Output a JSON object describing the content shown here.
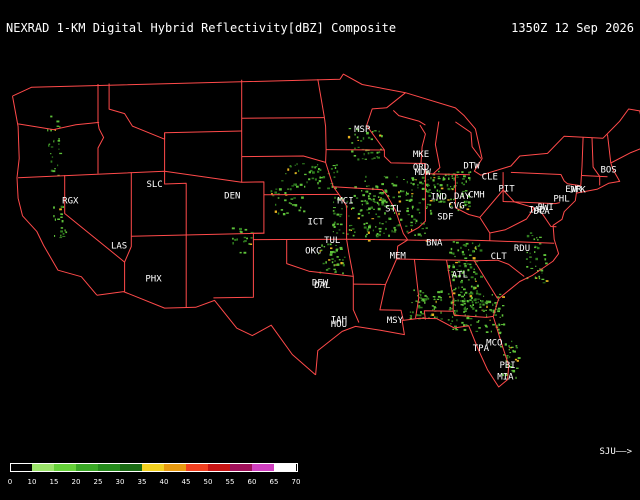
{
  "header": {
    "title": "NEXRAD 1-KM Digital Hybrid Reflectivity[dBZ] Composite",
    "timestamp": "1350Z 12 Sep 2026"
  },
  "cities": [
    {
      "code": "RGX",
      "lon": -119.5,
      "lat": 39.75
    },
    {
      "code": "SLC",
      "lon": -111.9,
      "lat": 40.8
    },
    {
      "code": "LAS",
      "lon": -115.1,
      "lat": 36.1
    },
    {
      "code": "PHX",
      "lon": -112.0,
      "lat": 33.4
    },
    {
      "code": "DEN",
      "lon": -104.9,
      "lat": 39.75
    },
    {
      "code": "MSP",
      "lon": -93.2,
      "lat": 44.9
    },
    {
      "code": "MKE",
      "lon": -87.9,
      "lat": 43.0
    },
    {
      "code": "ORD",
      "lon": -87.9,
      "lat": 41.98
    },
    {
      "code": "MDW",
      "lon": -87.75,
      "lat": 41.6
    },
    {
      "code": "DTW",
      "lon": -83.35,
      "lat": 42.21
    },
    {
      "code": "CLE",
      "lon": -81.7,
      "lat": 41.4
    },
    {
      "code": "CMH",
      "lon": -82.9,
      "lat": 39.95
    },
    {
      "code": "DAY",
      "lon": -84.2,
      "lat": 39.8
    },
    {
      "code": "PIT",
      "lon": -80.2,
      "lat": 40.5
    },
    {
      "code": "IND",
      "lon": -86.3,
      "lat": 39.7
    },
    {
      "code": "CVG",
      "lon": -84.7,
      "lat": 39.05
    },
    {
      "code": "MCI",
      "lon": -94.7,
      "lat": 39.3
    },
    {
      "code": "STL",
      "lon": -90.4,
      "lat": 38.7
    },
    {
      "code": "SDF",
      "lon": -85.7,
      "lat": 38.17
    },
    {
      "code": "ICT",
      "lon": -97.4,
      "lat": 37.65
    },
    {
      "code": "TUL",
      "lon": -95.9,
      "lat": 36.2
    },
    {
      "code": "OKC",
      "lon": -97.6,
      "lat": 35.4
    },
    {
      "code": "BNA",
      "lon": -86.7,
      "lat": 36.1
    },
    {
      "code": "MEM",
      "lon": -90.0,
      "lat": 35.05
    },
    {
      "code": "ATL",
      "lon": -84.4,
      "lat": 33.64
    },
    {
      "code": "CLT",
      "lon": -80.9,
      "lat": 35.2
    },
    {
      "code": "RDU",
      "lon": -78.8,
      "lat": 35.9
    },
    {
      "code": "DFW",
      "lon": -97.0,
      "lat": 32.9
    },
    {
      "code": "DAL",
      "lon": -96.8,
      "lat": 32.7
    },
    {
      "code": "IAH",
      "lon": -95.3,
      "lat": 30.0
    },
    {
      "code": "HOU",
      "lon": -95.3,
      "lat": 29.65
    },
    {
      "code": "MSY",
      "lon": -90.25,
      "lat": 29.99
    },
    {
      "code": "TPA",
      "lon": -82.5,
      "lat": 27.98
    },
    {
      "code": "MCO",
      "lon": -81.3,
      "lat": 28.43
    },
    {
      "code": "PBI",
      "lon": -80.1,
      "lat": 26.7
    },
    {
      "code": "MIA",
      "lon": -80.3,
      "lat": 25.79
    },
    {
      "code": "BOS",
      "lon": -71.0,
      "lat": 42.36
    },
    {
      "code": "JFK",
      "lon": -73.8,
      "lat": 40.64
    },
    {
      "code": "EWR",
      "lon": -74.17,
      "lat": 40.69
    },
    {
      "code": "PHL",
      "lon": -75.24,
      "lat": 39.87
    },
    {
      "code": "BWI",
      "lon": -76.67,
      "lat": 39.18
    },
    {
      "code": "IAD",
      "lon": -77.46,
      "lat": 38.95
    },
    {
      "code": "DCA",
      "lon": -77.04,
      "lat": 38.85
    }
  ],
  "legend": {
    "levels": [
      "0",
      "10",
      "15",
      "20",
      "25",
      "30",
      "35",
      "40",
      "45",
      "50",
      "55",
      "60",
      "65",
      "70"
    ],
    "colors": [
      "#000000",
      "#000000",
      "#9be36a",
      "#66d13a",
      "#3aa826",
      "#258a1c",
      "#1a6b14",
      "#f2d020",
      "#e89a10",
      "#f04020",
      "#c81414",
      "#a0105a",
      "#d040c0",
      "#ffffff"
    ]
  },
  "signature": "SJU——>",
  "colors": {
    "background": "#000000",
    "borders": "#ff4a4a",
    "text": "#ffffff",
    "echo_light": "#5ec23a",
    "echo_dark": "#2f7d1f",
    "echo_heavy": "#e8b020"
  }
}
